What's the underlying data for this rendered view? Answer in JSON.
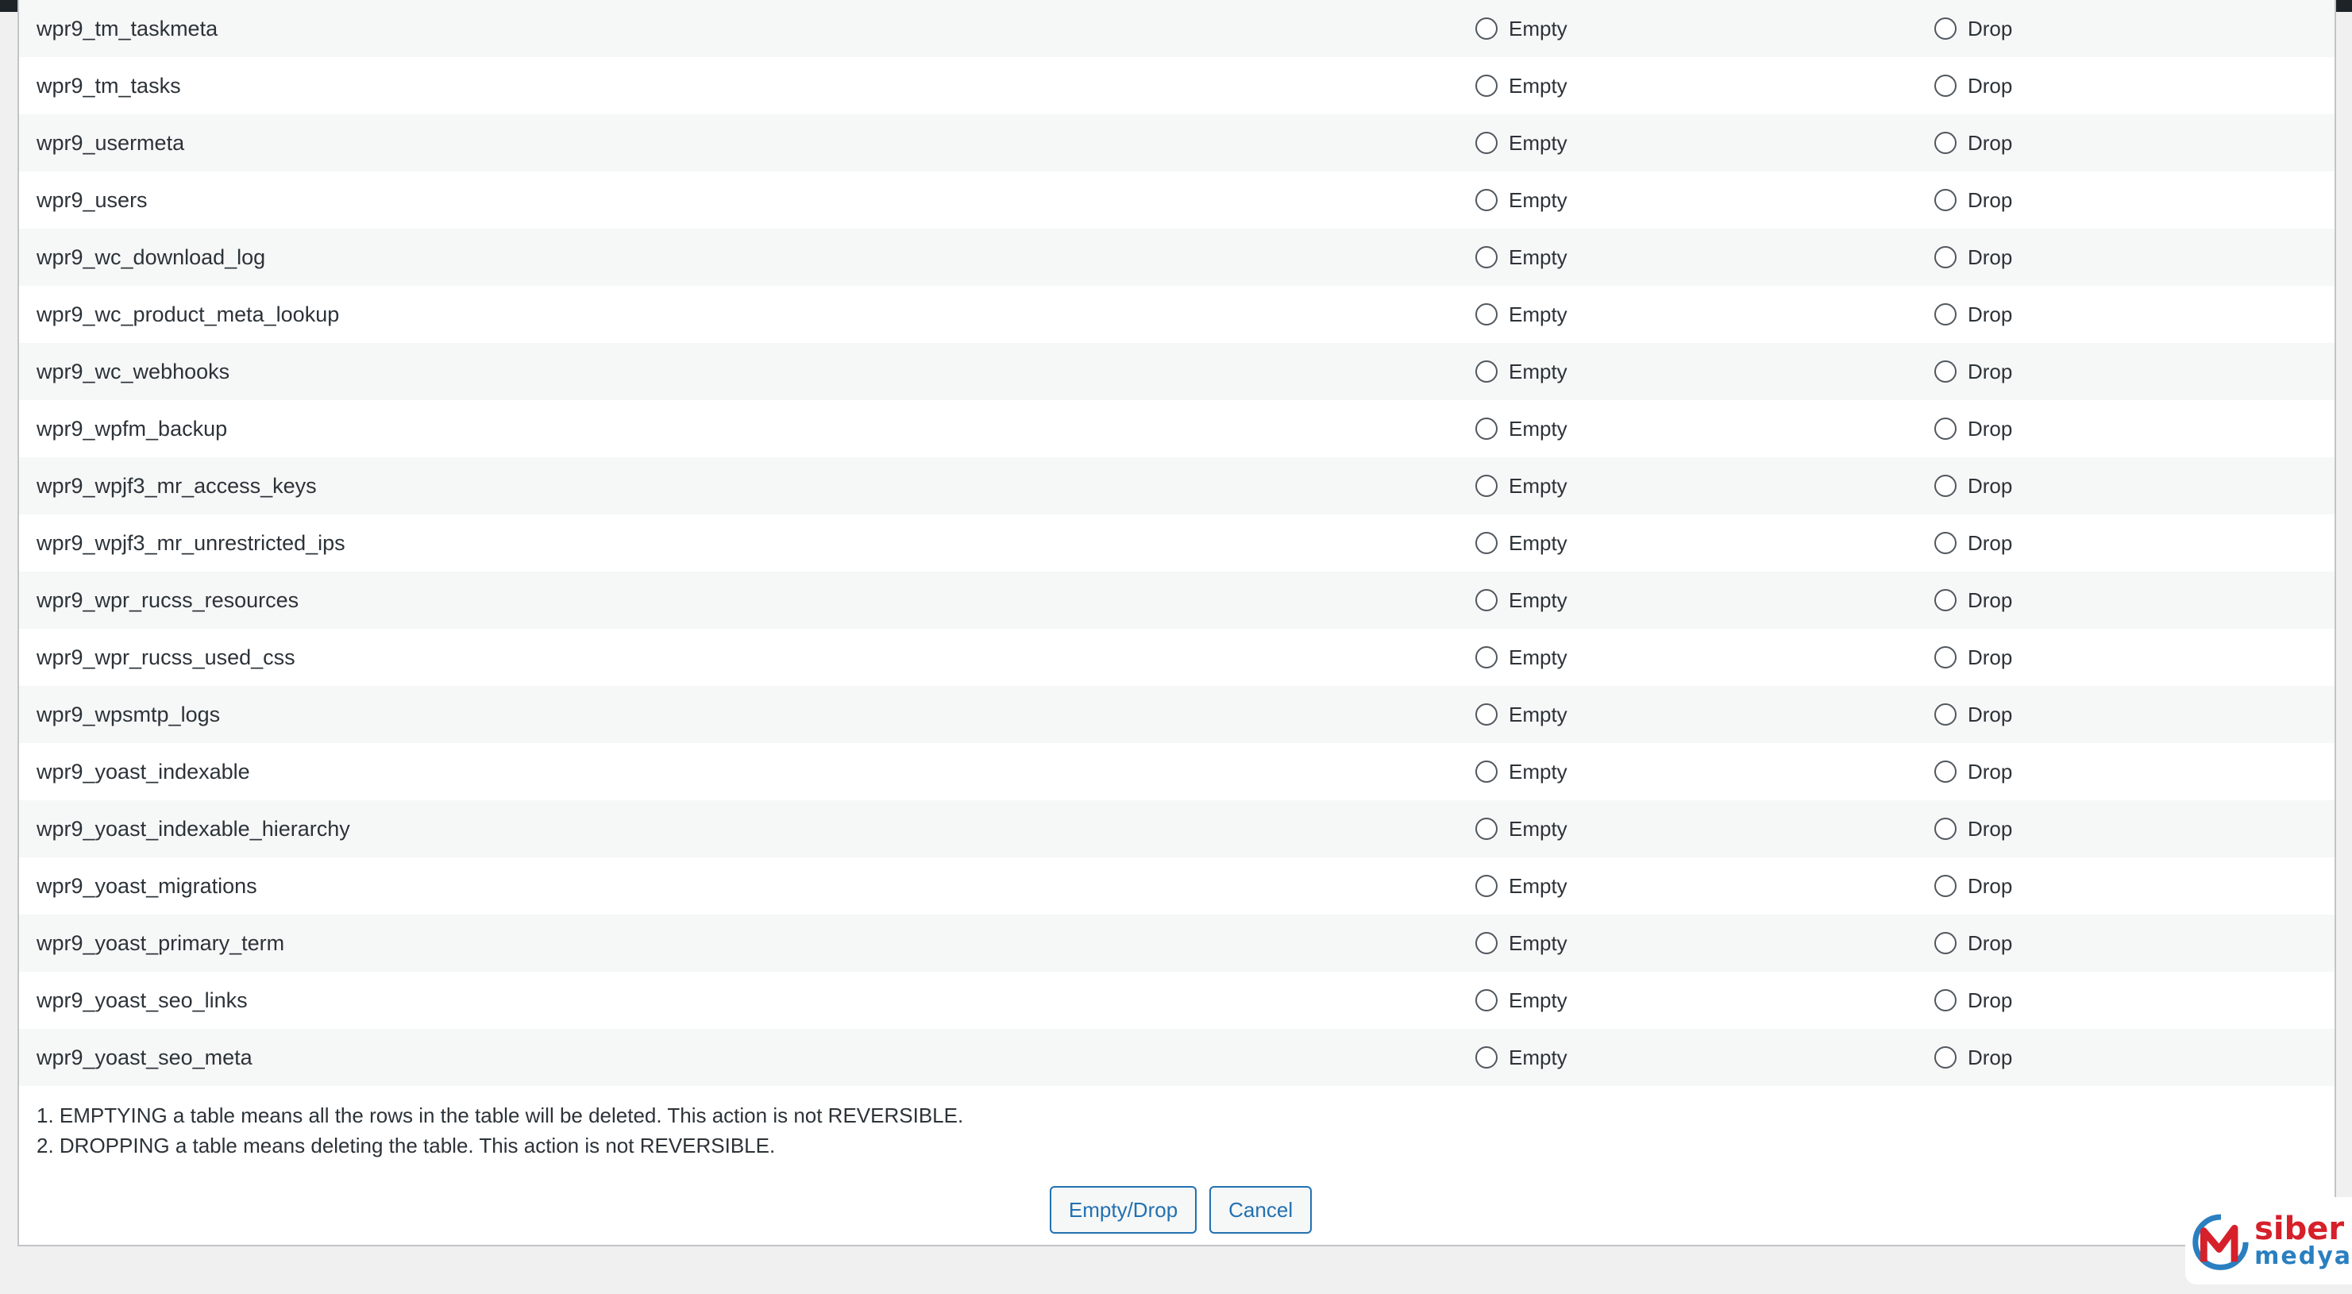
{
  "tables": [
    {
      "name": "wpr9_tm_taskmeta",
      "empty_label": "Empty",
      "drop_label": "Drop"
    },
    {
      "name": "wpr9_tm_tasks",
      "empty_label": "Empty",
      "drop_label": "Drop"
    },
    {
      "name": "wpr9_usermeta",
      "empty_label": "Empty",
      "drop_label": "Drop"
    },
    {
      "name": "wpr9_users",
      "empty_label": "Empty",
      "drop_label": "Drop"
    },
    {
      "name": "wpr9_wc_download_log",
      "empty_label": "Empty",
      "drop_label": "Drop"
    },
    {
      "name": "wpr9_wc_product_meta_lookup",
      "empty_label": "Empty",
      "drop_label": "Drop"
    },
    {
      "name": "wpr9_wc_webhooks",
      "empty_label": "Empty",
      "drop_label": "Drop"
    },
    {
      "name": "wpr9_wpfm_backup",
      "empty_label": "Empty",
      "drop_label": "Drop"
    },
    {
      "name": "wpr9_wpjf3_mr_access_keys",
      "empty_label": "Empty",
      "drop_label": "Drop"
    },
    {
      "name": "wpr9_wpjf3_mr_unrestricted_ips",
      "empty_label": "Empty",
      "drop_label": "Drop"
    },
    {
      "name": "wpr9_wpr_rucss_resources",
      "empty_label": "Empty",
      "drop_label": "Drop"
    },
    {
      "name": "wpr9_wpr_rucss_used_css",
      "empty_label": "Empty",
      "drop_label": "Drop"
    },
    {
      "name": "wpr9_wpsmtp_logs",
      "empty_label": "Empty",
      "drop_label": "Drop"
    },
    {
      "name": "wpr9_yoast_indexable",
      "empty_label": "Empty",
      "drop_label": "Drop"
    },
    {
      "name": "wpr9_yoast_indexable_hierarchy",
      "empty_label": "Empty",
      "drop_label": "Drop"
    },
    {
      "name": "wpr9_yoast_migrations",
      "empty_label": "Empty",
      "drop_label": "Drop"
    },
    {
      "name": "wpr9_yoast_primary_term",
      "empty_label": "Empty",
      "drop_label": "Drop"
    },
    {
      "name": "wpr9_yoast_seo_links",
      "empty_label": "Empty",
      "drop_label": "Drop"
    },
    {
      "name": "wpr9_yoast_seo_meta",
      "empty_label": "Empty",
      "drop_label": "Drop"
    }
  ],
  "notes": {
    "line1": "1. EMPTYING a table means all the rows in the table will be deleted. This action is not REVERSIBLE.",
    "line2": "2. DROPPING a table means deleting the table. This action is not REVERSIBLE."
  },
  "actions": {
    "submit_label": "Empty/Drop",
    "cancel_label": "Cancel"
  },
  "watermark": {
    "line1": "siber",
    "line2": "medya",
    "primary_color": "#d6202a",
    "secondary_color": "#2a7fc0"
  },
  "colors": {
    "accent": "#2271b1",
    "row_alt": "#f6f7f7",
    "admin_bar": "#1d2327"
  }
}
